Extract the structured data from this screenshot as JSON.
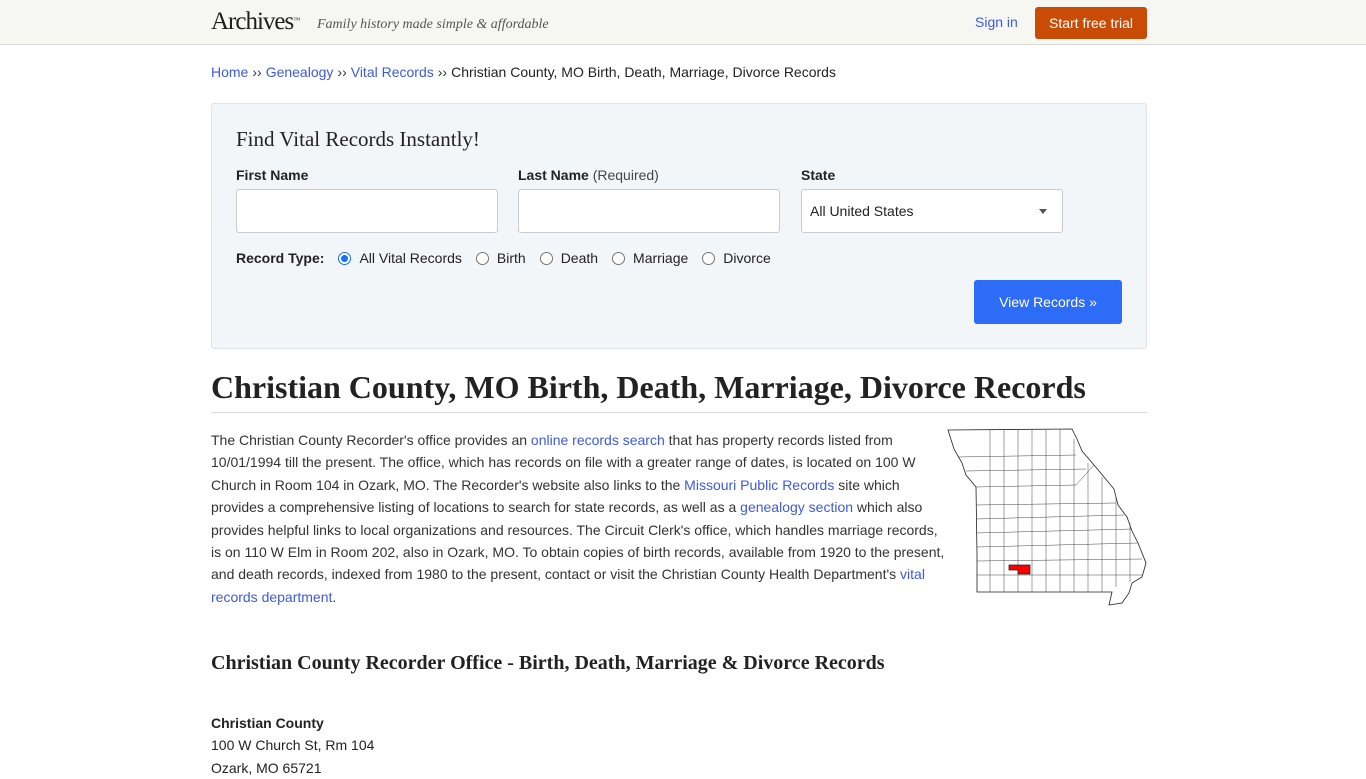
{
  "header": {
    "logo": "Archives",
    "logo_mark": "™",
    "tagline": "Family history made simple & affordable",
    "sign_in": "Sign in",
    "cta": "Start free trial",
    "cta_color": "#c84b06"
  },
  "breadcrumb": {
    "separator": "››",
    "items": [
      {
        "label": "Home",
        "link": true
      },
      {
        "label": "Genealogy",
        "link": true
      },
      {
        "label": "Vital Records",
        "link": true
      },
      {
        "label": "Christian County, MO Birth, Death, Marriage, Divorce Records",
        "link": false
      }
    ]
  },
  "search": {
    "title": "Find Vital Records Instantly!",
    "first_name_label": "First Name",
    "first_name_value": "",
    "last_name_label": "Last Name",
    "last_name_required": "(Required)",
    "last_name_value": "",
    "state_label": "State",
    "state_selected": "All United States",
    "record_type_label": "Record Type:",
    "record_types": [
      {
        "label": "All Vital Records",
        "checked": true
      },
      {
        "label": "Birth",
        "checked": false
      },
      {
        "label": "Death",
        "checked": false
      },
      {
        "label": "Marriage",
        "checked": false
      },
      {
        "label": "Divorce",
        "checked": false
      }
    ],
    "submit": "View Records »",
    "submit_color": "#2c6cf6"
  },
  "page": {
    "title": "Christian County, MO Birth, Death, Marriage, Divorce Records",
    "paragraph": {
      "t1": "The Christian County Recorder's office provides an ",
      "l1": "online records search",
      "t2": " that has property records listed from 10/01/1994 till the present. The office, which has records on file with a greater range of dates, is located on 100 W Church in Room 104 in Ozark, MO. The Recorder's website also links to the ",
      "l2": "Missouri Public Records",
      "t3": " site which provides a comprehensive listing of locations to search for state records, as well as a ",
      "l3": "genealogy section",
      "t4": " which also provides helpful links to local organizations and resources. The Circuit Clerk's office, which handles marriage records, is on 110 W Elm in Room 202, also in Ozark, MO. To obtain copies of birth records, available from 1920 to the present, and death records, indexed from 1980 to the present, contact or visit the Christian County Health Department's ",
      "l4": "vital records department",
      "t5": "."
    },
    "map": {
      "state": "Missouri",
      "highlighted_county": "Christian County",
      "highlight_color": "#ff0000"
    },
    "section_title": "Christian County Recorder Office - Birth, Death, Marriage & Divorce Records",
    "office": {
      "name": "Christian County",
      "address1": "100 W Church St, Rm 104",
      "address2": "Ozark, MO 65721"
    }
  }
}
